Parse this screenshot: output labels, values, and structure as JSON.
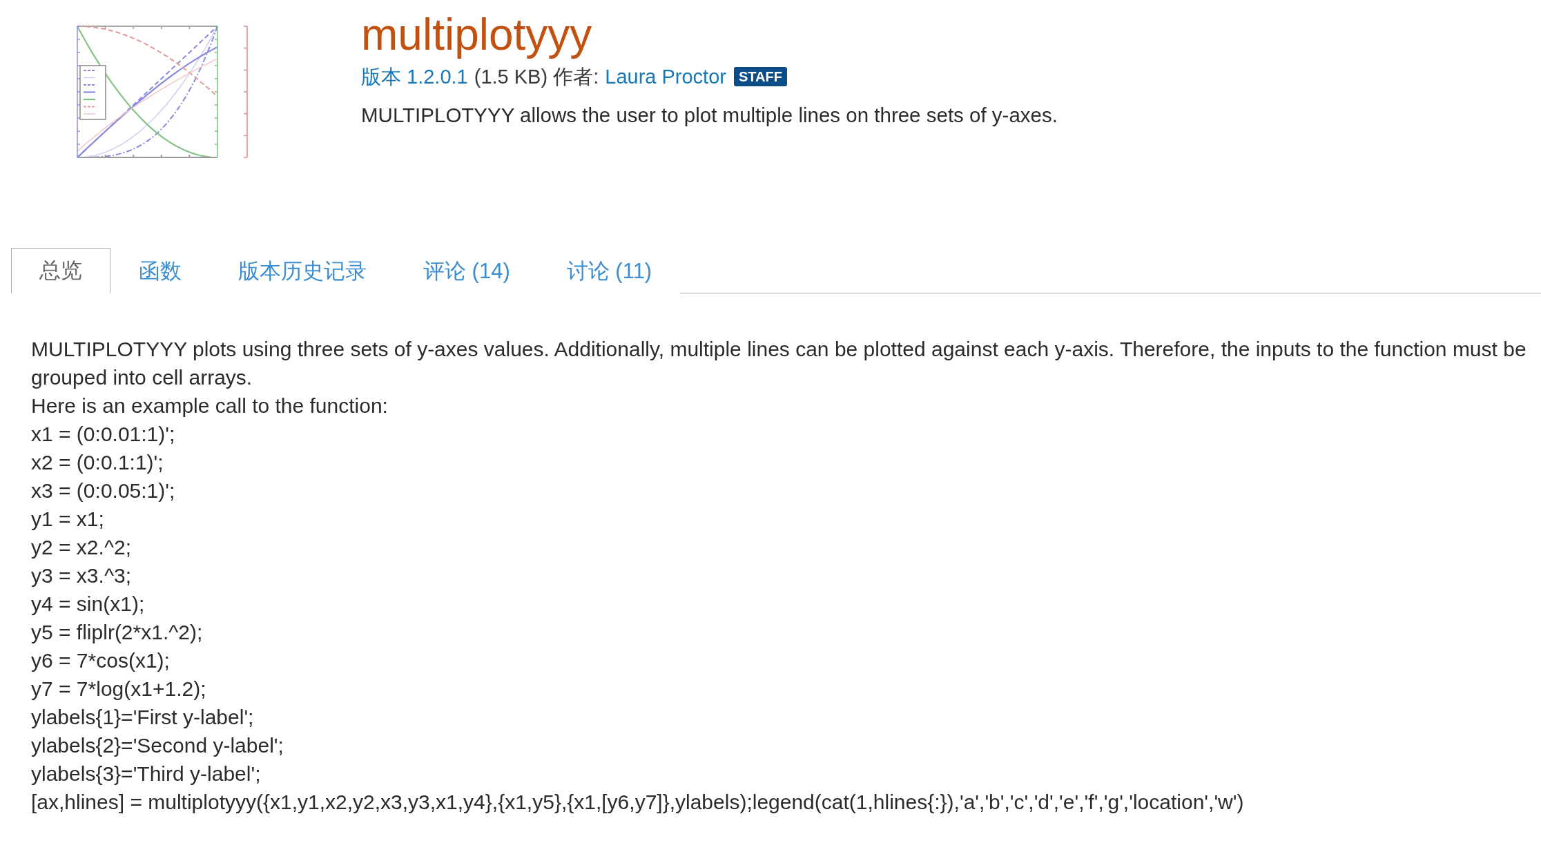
{
  "title": "multiplotyyy",
  "meta": {
    "version": "版本 1.2.0.1",
    "size_author": "(1.5 KB) 作者:",
    "author": "Laura Proctor",
    "badge": "STAFF"
  },
  "summary": "MULTIPLOTYYY allows the user to plot multiple lines on three sets of y-axes.",
  "tabs": [
    {
      "label": "总览",
      "selected": true
    },
    {
      "label": "函数",
      "selected": false
    },
    {
      "label": "版本历史记录",
      "selected": false
    },
    {
      "label": "评论 (14)",
      "selected": false
    },
    {
      "label": "讨论 (11)",
      "selected": false
    }
  ],
  "description": [
    "MULTIPLOTYYY plots using three sets of y-axes values. Additionally, multiple lines can be plotted against each y-axis. Therefore, the inputs to the function must be grouped into cell arrays.",
    "Here is an example call to the function:"
  ],
  "example_code": [
    "x1 = (0:0.01:1)';",
    "x2 = (0:0.1:1)';",
    "x3 = (0:0.05:1)';",
    "y1 = x1;",
    "y2 = x2.^2;",
    "y3 = x3.^3;",
    "y4 = sin(x1);",
    "y5 = fliplr(2*x1.^2);",
    "y6 = 7*cos(x1);",
    "y7 = 7*log(x1+1.2);",
    "ylabels{1}='First y-label';",
    "ylabels{2}='Second y-label';",
    "ylabels{3}='Third y-label';",
    "[ax,hlines] = multiplotyyy({x1,y1,x2,y2,x3,y3,x1,y4},{x1,y5},{x1,[y6,y7]},ylabels);legend(cat(1,hlines{:}),'a','b','c','d','e','f','g','location','w')"
  ]
}
